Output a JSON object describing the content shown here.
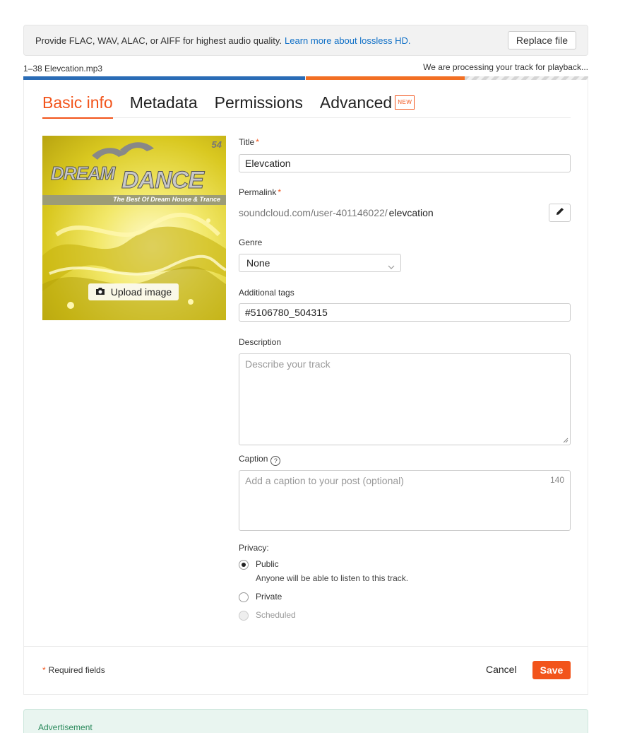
{
  "notice": {
    "text": "Provide FLAC, WAV, ALAC, or AIFF for highest audio quality.",
    "link": "Learn more about lossless HD.",
    "replace_button": "Replace file"
  },
  "upload": {
    "file_name": "1–38 Elevcation.mp3",
    "status": "We are processing your track for playback..."
  },
  "tabs": [
    {
      "label": "Basic info",
      "active": true
    },
    {
      "label": "Metadata",
      "active": false
    },
    {
      "label": "Permissions",
      "active": false
    },
    {
      "label": "Advanced",
      "active": false,
      "badge": "NEW"
    }
  ],
  "artwork": {
    "title_line1": "DREAM",
    "title_line2": "DANCE",
    "subtitle": "The Best Of Dream House & Trance",
    "number": "54",
    "upload_label": "Upload image"
  },
  "form": {
    "title_label": "Title",
    "title_value": "Elevcation",
    "permalink_label": "Permalink",
    "permalink_base": "soundcloud.com/user-401146022/",
    "permalink_slug": "elevcation",
    "genre_label": "Genre",
    "genre_value": "None",
    "tags_label": "Additional tags",
    "tags_value": "#5106780_504315",
    "description_label": "Description",
    "description_placeholder": "Describe your track",
    "caption_label": "Caption",
    "caption_placeholder": "Add a caption to your post (optional)",
    "caption_counter": "140",
    "required_marker": "*",
    "help_glyph": "?"
  },
  "privacy": {
    "label": "Privacy:",
    "options": [
      {
        "label": "Public",
        "description": "Anyone will be able to listen to this track.",
        "checked": true,
        "disabled": false
      },
      {
        "label": "Private",
        "checked": false,
        "disabled": false
      },
      {
        "label": "Scheduled",
        "checked": false,
        "disabled": true
      }
    ]
  },
  "footer": {
    "required_note": "Required fields",
    "cancel": "Cancel",
    "save": "Save"
  },
  "advertisement": {
    "label": "Advertisement"
  },
  "colors": {
    "accent": "#f2541b",
    "link": "#0f6fc6",
    "progress_blue": "#2a6cb6",
    "progress_orange": "#f26f23"
  }
}
